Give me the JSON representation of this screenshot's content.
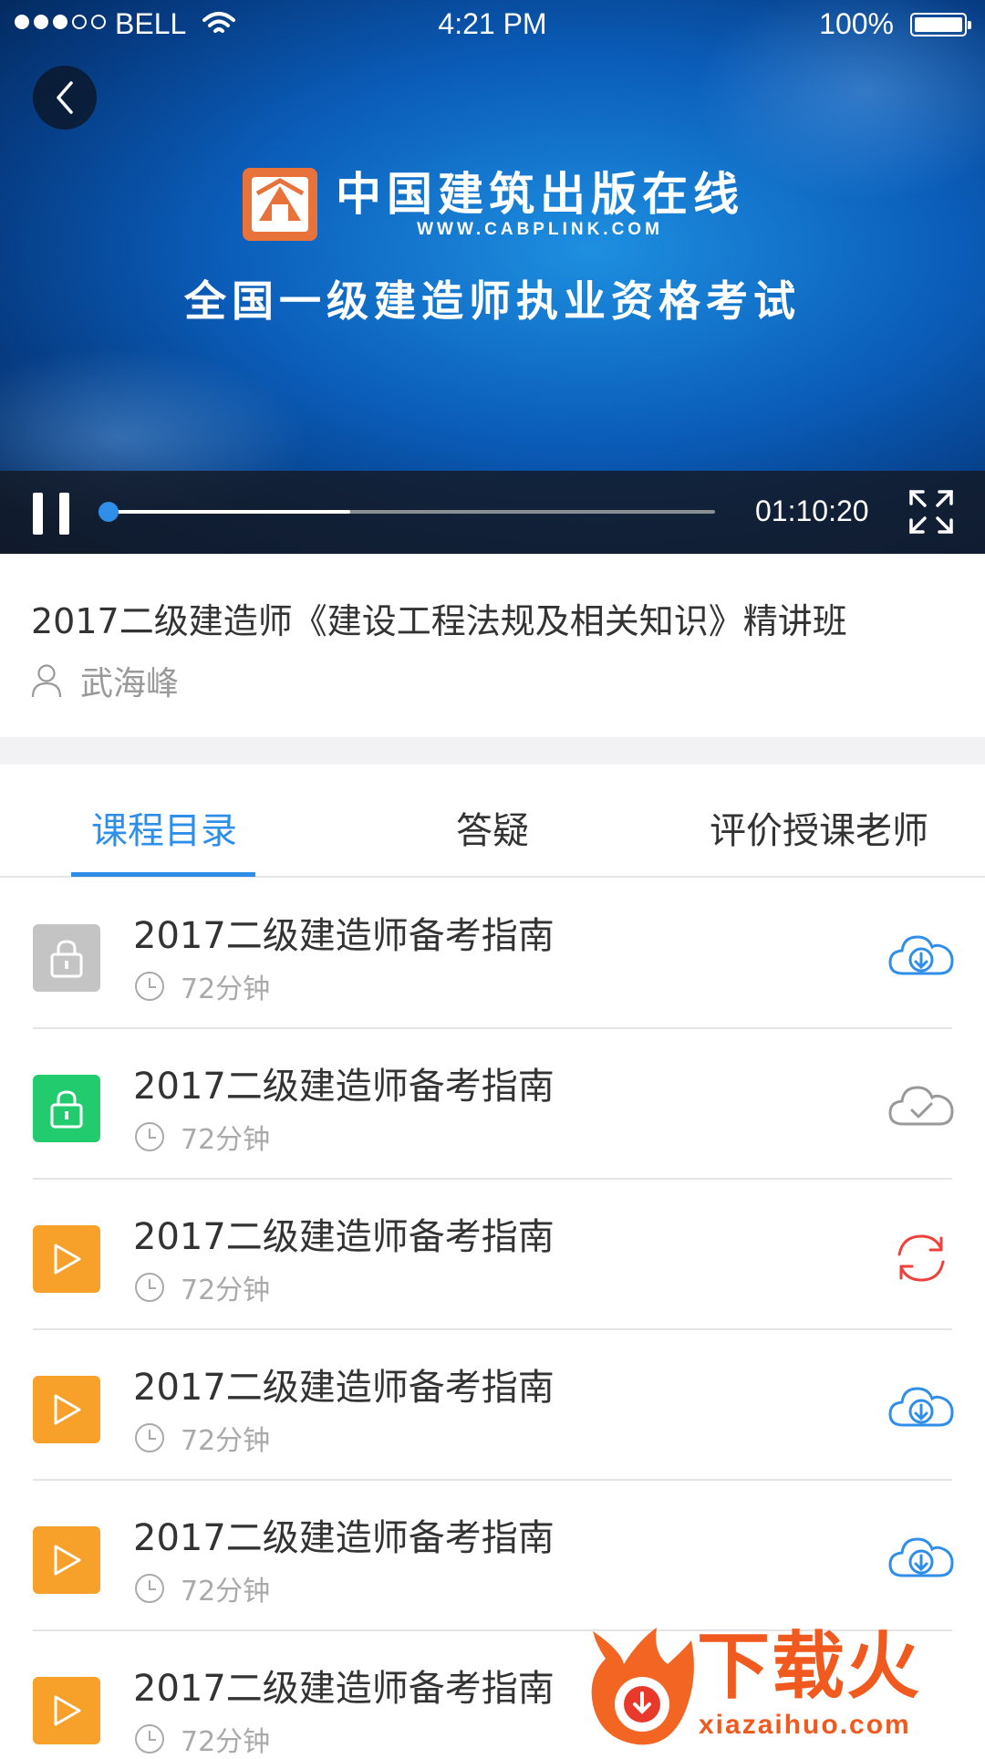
{
  "status_bar": {
    "signal": "●●●○○",
    "carrier": "BELL",
    "time": "4:21 PM",
    "battery": "100%"
  },
  "player": {
    "logo_cn": "中国建筑出版在线",
    "logo_url": "WWW.CABPLINK.COM",
    "headline": "全国一级建造师执业资格考试",
    "time": "01:10:20",
    "progress_played": 0.4,
    "state": "playing",
    "icons": [
      "back-icon",
      "pause-icon",
      "fullscreen-icon"
    ]
  },
  "course": {
    "title": "2017二级建造师《建设工程法规及相关知识》精讲班",
    "teacher": "武海峰"
  },
  "tabs": [
    {
      "label": "课程目录",
      "active": true
    },
    {
      "label": "答疑",
      "active": false
    },
    {
      "label": "评价授课老师",
      "active": false
    }
  ],
  "lessons": [
    {
      "title": "2017二级建造师备考指南",
      "duration": "72分钟",
      "badge": "lock-locked",
      "badge_color": "#c4c4c4",
      "action": "cloud-download",
      "action_color": "#2f8fe8"
    },
    {
      "title": "2017二级建造师备考指南",
      "duration": "72分钟",
      "badge": "lock-unlocked",
      "badge_color": "#22cc6e",
      "action": "cloud-done",
      "action_color": "#999999"
    },
    {
      "title": "2017二级建造师备考指南",
      "duration": "72分钟",
      "badge": "play",
      "badge_color": "#f7a12a",
      "action": "sync",
      "action_color": "#f0403c"
    },
    {
      "title": "2017二级建造师备考指南",
      "duration": "72分钟",
      "badge": "play",
      "badge_color": "#f7a12a",
      "action": "cloud-download",
      "action_color": "#2f8fe8"
    },
    {
      "title": "2017二级建造师备考指南",
      "duration": "72分钟",
      "badge": "play",
      "badge_color": "#f7a12a",
      "action": "cloud-download",
      "action_color": "#2f8fe8"
    },
    {
      "title": "2017二级建造师备考指南",
      "duration": "72分钟",
      "badge": "play",
      "badge_color": "#f7a12a",
      "action": "none",
      "action_color": ""
    }
  ],
  "watermark": {
    "text": "下载火",
    "url": "xiazaihuo.com"
  },
  "colors": {
    "accent": "#2f8fe8",
    "video_bg": "#0a5cb8"
  }
}
